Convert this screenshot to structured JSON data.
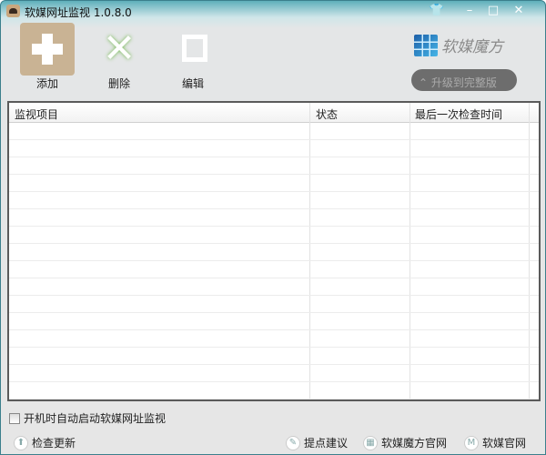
{
  "window": {
    "title": "软媒网址监视 1.0.8.0",
    "controls": [
      "skin",
      "minimize",
      "maximize",
      "close"
    ]
  },
  "toolbar": {
    "add": "添加",
    "delete": "删除",
    "edit": "编辑"
  },
  "brand": {
    "name": "软媒魔方",
    "upgrade": "升级到完整版"
  },
  "table": {
    "columns": [
      "监视项目",
      "状态",
      "最后一次检查时间"
    ],
    "rows": []
  },
  "options": {
    "autostart": "开机时自动启动软媒网址监视",
    "autostart_checked": false
  },
  "footer": {
    "check_update": "检查更新",
    "feedback": "提点建议",
    "mofang_site": "软媒魔方官网",
    "ruanmei_site": "软媒官网"
  }
}
